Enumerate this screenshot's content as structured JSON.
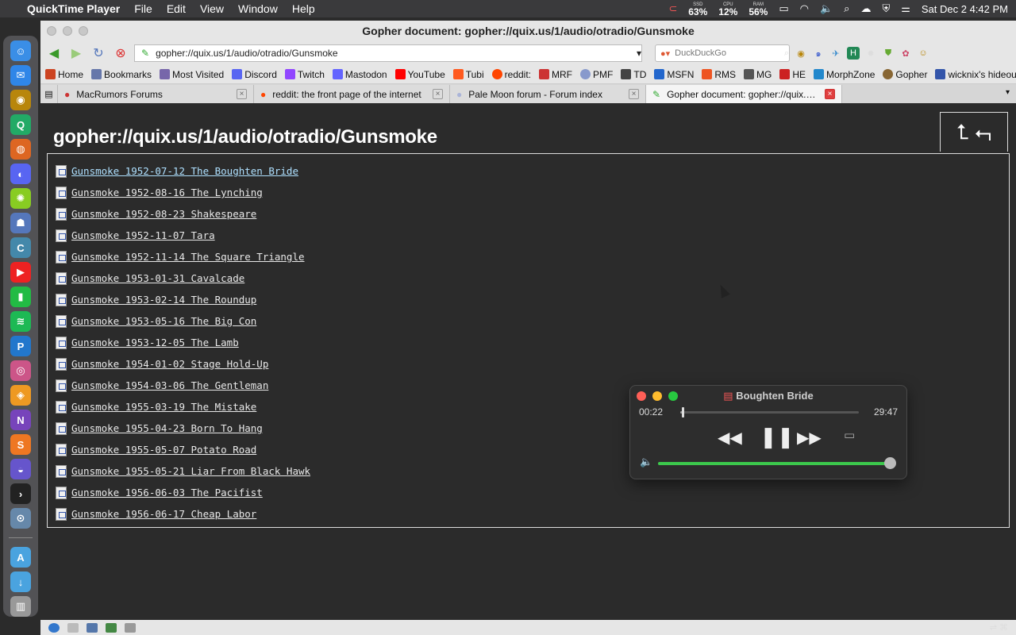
{
  "menubar": {
    "app_name": "QuickTime Player",
    "menus": [
      "File",
      "Edit",
      "View",
      "Window",
      "Help"
    ],
    "stats": [
      {
        "label": "SSD",
        "value": "63%"
      },
      {
        "label": "CPU",
        "value": "12%"
      },
      {
        "label": "RAM",
        "value": "56%"
      }
    ],
    "clock": "Sat Dec 2  4:42 PM"
  },
  "browser": {
    "window_title": "Gopher document: gopher://quix.us/1/audio/otradio/Gunsmoke",
    "url": "gopher://quix.us/1/audio/otradio/Gunsmoke",
    "search_placeholder": "DuckDuckGo",
    "bookmarks": [
      {
        "label": "Home",
        "color": "#cc4422"
      },
      {
        "label": "Bookmarks",
        "color": "#6677aa"
      },
      {
        "label": "Most Visited",
        "color": "#7766aa"
      },
      {
        "label": "Discord",
        "color": "#5865f2"
      },
      {
        "label": "Twitch",
        "color": "#9146ff"
      },
      {
        "label": "Mastodon",
        "color": "#6364ff"
      },
      {
        "label": "YouTube",
        "color": "#ff0000"
      },
      {
        "label": "Tubi",
        "color": "#ff5a1f"
      },
      {
        "label": "reddit:",
        "color": "#ff4500"
      },
      {
        "label": "MRF",
        "color": "#cc3333"
      },
      {
        "label": "PMF",
        "color": "#8899cc"
      },
      {
        "label": "TD",
        "color": "#444444"
      },
      {
        "label": "MSFN",
        "color": "#2266cc"
      },
      {
        "label": "RMS",
        "color": "#ee5522"
      },
      {
        "label": "MG",
        "color": "#555555"
      },
      {
        "label": "HE",
        "color": "#cc2222"
      },
      {
        "label": "MorphZone",
        "color": "#2288cc"
      },
      {
        "label": "Gopher",
        "color": "#886633"
      },
      {
        "label": "wicknix's hideout",
        "color": "#3355aa"
      }
    ],
    "tabs": [
      {
        "label": "MacRumors Forums",
        "active": false
      },
      {
        "label": "reddit: the front page of the internet",
        "active": false
      },
      {
        "label": "Pale Moon forum - Forum index",
        "active": false
      },
      {
        "label": "Gopher document: gopher://quix.u...",
        "active": true
      }
    ]
  },
  "page": {
    "title": "gopher://quix.us/1/audio/otradio/Gunsmoke",
    "entries": [
      "Gunsmoke 1952-07-12 The Boughten Bride",
      "Gunsmoke 1952-08-16 The Lynching",
      "Gunsmoke 1952-08-23 Shakespeare",
      "Gunsmoke 1952-11-07 Tara",
      "Gunsmoke 1952-11-14 The Square Triangle",
      "Gunsmoke 1953-01-31 Cavalcade",
      "Gunsmoke 1953-02-14 The Roundup",
      "Gunsmoke 1953-05-16 The Big Con",
      "Gunsmoke 1953-12-05 The Lamb",
      "Gunsmoke 1954-01-02 Stage Hold-Up",
      "Gunsmoke 1954-03-06 The Gentleman",
      "Gunsmoke 1955-03-19 The Mistake",
      "Gunsmoke 1955-04-23 Born To Hang",
      "Gunsmoke 1955-05-07 Potato Road",
      "Gunsmoke 1955-05-21 Liar From Black Hawk",
      "Gunsmoke 1956-06-03 The Pacifist",
      "Gunsmoke 1956-06-17 Cheap Labor"
    ]
  },
  "player": {
    "title": "Boughten Bride",
    "elapsed": "00:22",
    "total": "29:47",
    "progress": 0.012,
    "volume": 1.0,
    "accent": "#3cc84c"
  }
}
